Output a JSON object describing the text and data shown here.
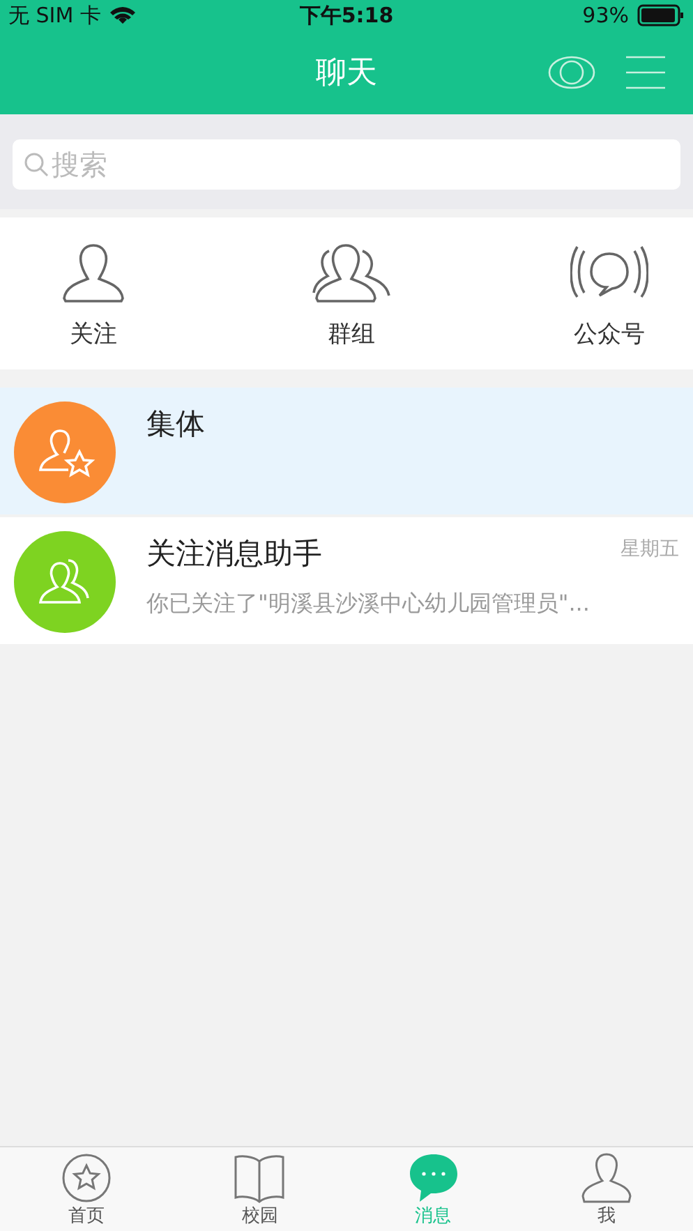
{
  "status_bar": {
    "carrier": "无 SIM 卡",
    "time": "下午5:18",
    "battery": "93%"
  },
  "header": {
    "title": "聊天"
  },
  "search": {
    "placeholder": "搜索"
  },
  "shortcuts": [
    {
      "kind": "person",
      "label": "关注"
    },
    {
      "kind": "group",
      "label": "群组"
    },
    {
      "kind": "broadcast",
      "label": "公众号"
    }
  ],
  "conversations": [
    {
      "kind": "star",
      "color": "#fa8c35",
      "name": "集体",
      "selected": true
    },
    {
      "kind": "people",
      "color": "#7ed321",
      "name": "关注消息助手",
      "time": "星期五",
      "preview": "你已关注了\"明溪县沙溪中心幼儿园管理员\"...",
      "selected": false
    }
  ],
  "tabs": [
    {
      "kind": "home",
      "label": "首页",
      "selected": false
    },
    {
      "kind": "book",
      "label": "校园",
      "selected": false
    },
    {
      "kind": "chat",
      "label": "消息",
      "selected": true
    },
    {
      "kind": "me",
      "label": "我",
      "selected": false
    }
  ]
}
